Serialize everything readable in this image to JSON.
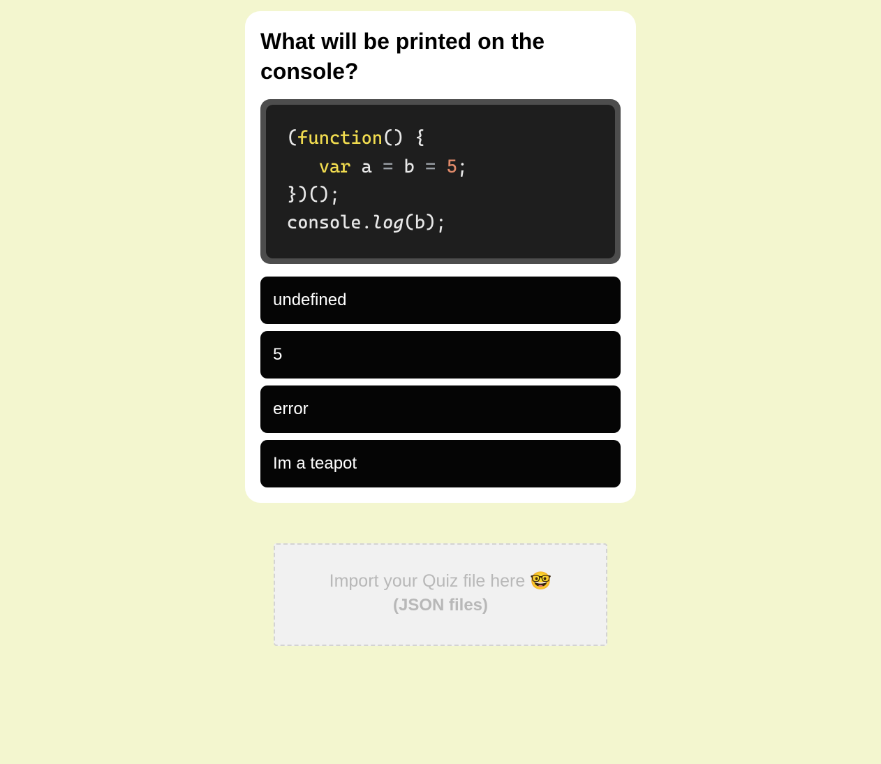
{
  "question": "What will be printed on the console?",
  "code": {
    "tokens": [
      {
        "t": "(",
        "c": "tok-punc"
      },
      {
        "t": "function",
        "c": "tok-kw"
      },
      {
        "t": "()",
        "c": "tok-punc"
      },
      {
        "t": " {",
        "c": "tok-punc"
      },
      {
        "t": "\n   ",
        "c": "tok-punc"
      },
      {
        "t": "var",
        "c": "tok-kw2"
      },
      {
        "t": " a ",
        "c": "tok-id"
      },
      {
        "t": "=",
        "c": "tok-op"
      },
      {
        "t": " b ",
        "c": "tok-id"
      },
      {
        "t": "=",
        "c": "tok-op"
      },
      {
        "t": " ",
        "c": "tok-punc"
      },
      {
        "t": "5",
        "c": "tok-num"
      },
      {
        "t": ";",
        "c": "tok-punc"
      },
      {
        "t": "\n})();",
        "c": "tok-punc"
      },
      {
        "t": "\nconsole",
        "c": "tok-id"
      },
      {
        "t": ".",
        "c": "tok-punc"
      },
      {
        "t": "log",
        "c": "tok-id tok-fn"
      },
      {
        "t": "(b);",
        "c": "tok-punc"
      }
    ]
  },
  "answers": [
    {
      "label": "undefined"
    },
    {
      "label": "5"
    },
    {
      "label": "error"
    },
    {
      "label": "Im a teapot"
    }
  ],
  "dropzone": {
    "line1": "Import your Quiz file here 🤓",
    "line2": "(JSON files)"
  }
}
